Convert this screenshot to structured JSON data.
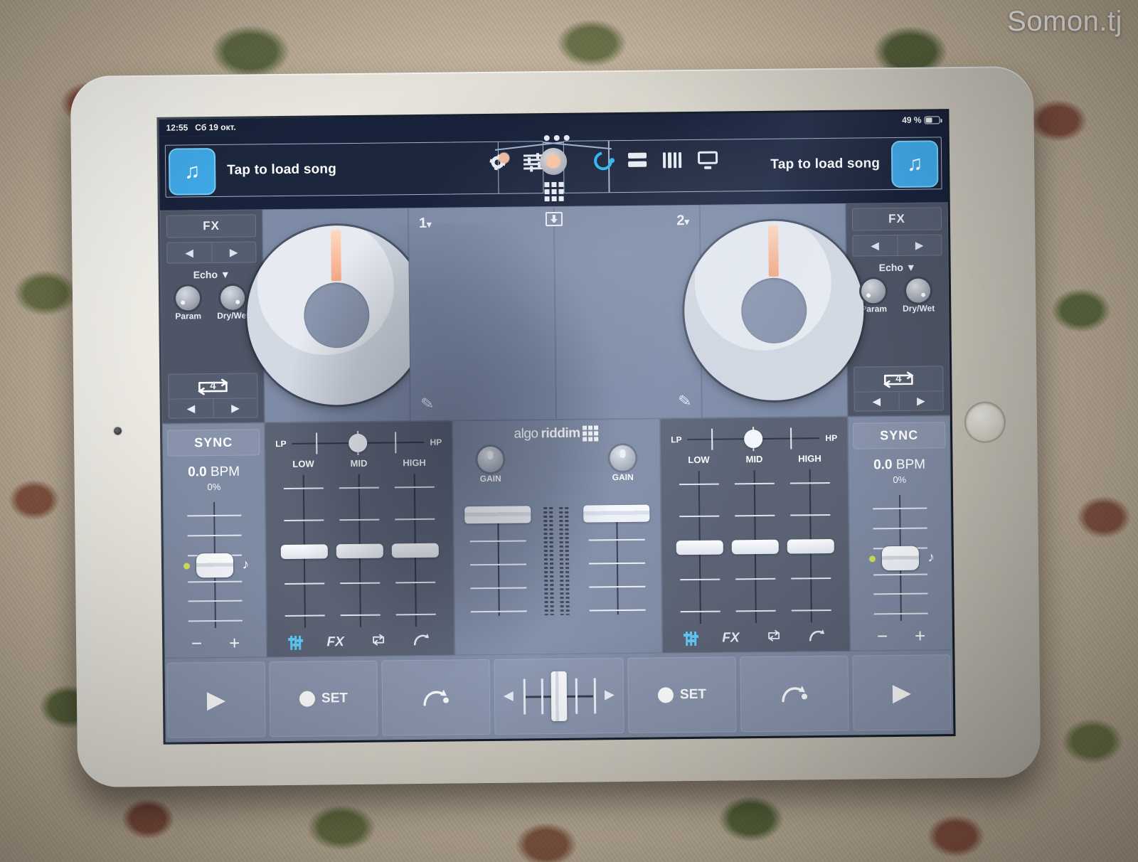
{
  "watermark": "Somon.tj",
  "status_bar": {
    "time": "12:55",
    "date": "Сб 19 окт.",
    "battery_percent": "49 %"
  },
  "top_bar": {
    "left_deck": {
      "song_label": "Tap to load song",
      "song_button_icon": "music-note-icon"
    },
    "right_deck": {
      "song_label": "Tap to load song",
      "song_button_icon": "music-note-icon"
    },
    "toolbar_icons": [
      "settings-gear-icon",
      "mixer-sliders-icon",
      "record-button-icon",
      "three-dots-icon",
      "grid-icon",
      "download-icon",
      "sync-spinner-icon",
      "split-rows-icon",
      "vertical-bars-icon",
      "monitor-icon"
    ]
  },
  "decks": {
    "left": {
      "number": "1",
      "dropdown_caret": "▾",
      "fx": {
        "title": "FX",
        "prev_label": "◀",
        "next_label": "▶",
        "effect_name": "Echo",
        "effect_caret": "▼",
        "param_label": "Param",
        "drywet_label": "Dry/Wet",
        "loop_beats": "4",
        "loop_prev": "◀",
        "loop_next": "▶"
      },
      "sync": {
        "button_label": "SYNC",
        "bpm_value": "0.0",
        "bpm_unit": "BPM",
        "pitch_percent": "0%",
        "minus_label": "−",
        "plus_label": "+"
      },
      "eq": {
        "filter_low_label": "LP",
        "filter_high_label": "HP",
        "bands": [
          "LOW",
          "MID",
          "HIGH"
        ],
        "mode_icons": [
          "eq-faders-icon",
          "fx-icon",
          "loop-icon",
          "cue-icon"
        ],
        "fx_text": "FX",
        "loop_glyph": "⟳",
        "active_mode": "eq-faders-icon"
      },
      "transport": {
        "play_label": "▶",
        "set_label": "SET",
        "cue_icon": "cue-arrow-icon"
      }
    },
    "right": {
      "number": "2",
      "dropdown_caret": "▾",
      "fx": {
        "title": "FX",
        "prev_label": "◀",
        "next_label": "▶",
        "effect_name": "Echo",
        "effect_caret": "▼",
        "param_label": "Param",
        "drywet_label": "Dry/Wet",
        "loop_beats": "4",
        "loop_prev": "◀",
        "loop_next": "▶"
      },
      "sync": {
        "button_label": "SYNC",
        "bpm_value": "0.0",
        "bpm_unit": "BPM",
        "pitch_percent": "0%",
        "minus_label": "−",
        "plus_label": "+"
      },
      "eq": {
        "filter_low_label": "LP",
        "filter_high_label": "HP",
        "bands": [
          "LOW",
          "MID",
          "HIGH"
        ],
        "mode_icons": [
          "eq-faders-icon",
          "fx-icon",
          "loop-icon",
          "cue-icon"
        ],
        "fx_text": "FX",
        "loop_glyph": "⟳",
        "active_mode": "eq-faders-icon"
      },
      "transport": {
        "play_label": "▶",
        "set_label": "SET",
        "cue_icon": "cue-arrow-icon"
      }
    }
  },
  "mixer": {
    "brand_first": "algo",
    "brand_second": "riddim",
    "gain_label_left": "GAIN",
    "gain_label_right": "GAIN",
    "crossfader_left_arrow": "◀",
    "crossfader_right_arrow": "▶"
  },
  "colors": {
    "accent_blue": "#3fa9e8",
    "mode_active_blue": "#5ec8f5",
    "jog_marker": "#f4a883",
    "panel_dark": "#4d5566",
    "panel_light": "#7f8ba3",
    "topbar_navy": "#18223a"
  }
}
